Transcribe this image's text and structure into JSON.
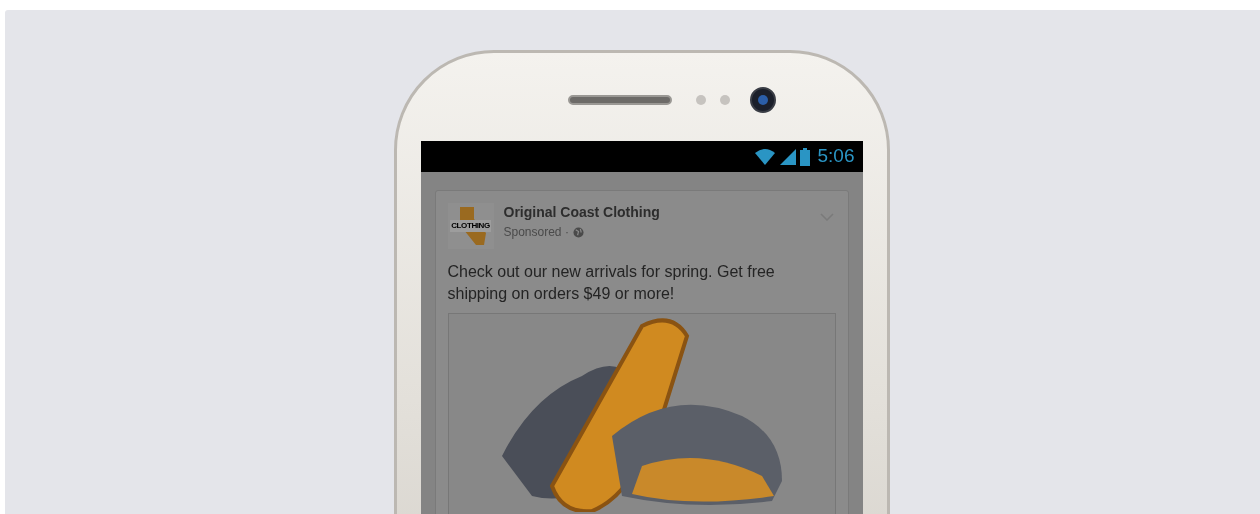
{
  "status_bar": {
    "time": "5:06"
  },
  "ad": {
    "logo_text": "CLOTHING",
    "page_name": "Original Coast Clothing",
    "sponsored_label": "Sponsored ·",
    "message": "Check out our new arrivals for spring. Get free shipping on orders $49 or more!"
  }
}
